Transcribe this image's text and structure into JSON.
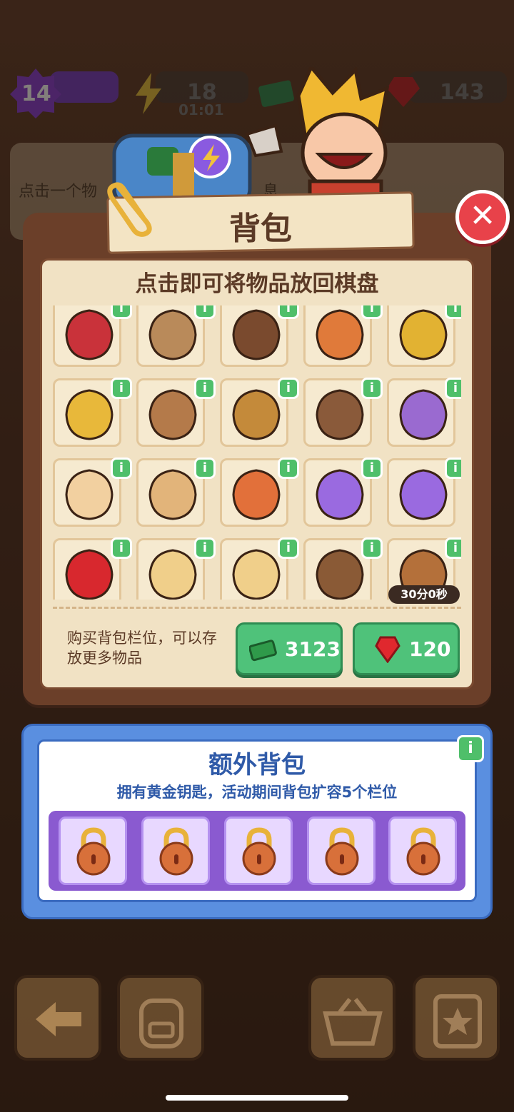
{
  "hud": {
    "level": "14",
    "energy": "18",
    "energy_timer": "01:01",
    "gems": "143"
  },
  "background_hint": {
    "text_start": "点击一个物",
    "text_end": "息"
  },
  "backpack": {
    "title": "背包",
    "subtitle": "点击即可将物品放回棋盘",
    "items": [
      {
        "name": "red-gloves",
        "color": "#c9323a"
      },
      {
        "name": "cookie-leaf",
        "color": "#b98a5a"
      },
      {
        "name": "wooden-box",
        "color": "#7a4a2e"
      },
      {
        "name": "road-barrier",
        "color": "#e07a3a"
      },
      {
        "name": "yellow-horseshoe",
        "color": "#e2b232"
      },
      {
        "name": "gold-coin-stack",
        "color": "#e8b83a"
      },
      {
        "name": "clay-pot",
        "color": "#b47a4a"
      },
      {
        "name": "pocket-watch",
        "color": "#c48a3a"
      },
      {
        "name": "highland-cow",
        "color": "#8a5a3a"
      },
      {
        "name": "moth",
        "color": "#9a6ad0"
      },
      {
        "name": "lucky-cat",
        "color": "#f2d0a0"
      },
      {
        "name": "hourglass-tile-tan",
        "color": "#e2b47a"
      },
      {
        "name": "hourglass-tile-orange",
        "color": "#e2703a"
      },
      {
        "name": "energy-orb",
        "color": "#9a6ae0"
      },
      {
        "name": "energy-orb",
        "color": "#9a6ae0"
      },
      {
        "name": "red-gems",
        "color": "#d8282e"
      },
      {
        "name": "tofu-cubes-2",
        "color": "#f0cf8a"
      },
      {
        "name": "tofu-cubes-3",
        "color": "#f0cf8a"
      },
      {
        "name": "pottery-cone",
        "color": "#8a5a36"
      },
      {
        "name": "hourglass-lid",
        "color": "#b4703a"
      }
    ],
    "timer": "30分0秒",
    "buy_text": "购买背包栏位，可以存放更多物品",
    "buy_cash": "3123",
    "buy_gems": "120"
  },
  "extra_backpack": {
    "title": "额外背包",
    "subtitle": "拥有黄金钥匙，活动期间背包扩容5个栏位",
    "locked_slots": 5
  },
  "colors": {
    "panel": "#6b3f29",
    "cream": "#f1e2c4",
    "green": "#4fc27a",
    "blue": "#5a8fe0",
    "purple": "#8a5ad0",
    "close_red": "#e8424a"
  },
  "icons": [
    "level-star-icon",
    "energy-bolt-icon",
    "cash-icon",
    "gem-icon",
    "close-icon",
    "info-icon",
    "lock-icon",
    "back-arrow-icon",
    "backpack-icon",
    "basket-icon",
    "clipboard-star-icon"
  ]
}
